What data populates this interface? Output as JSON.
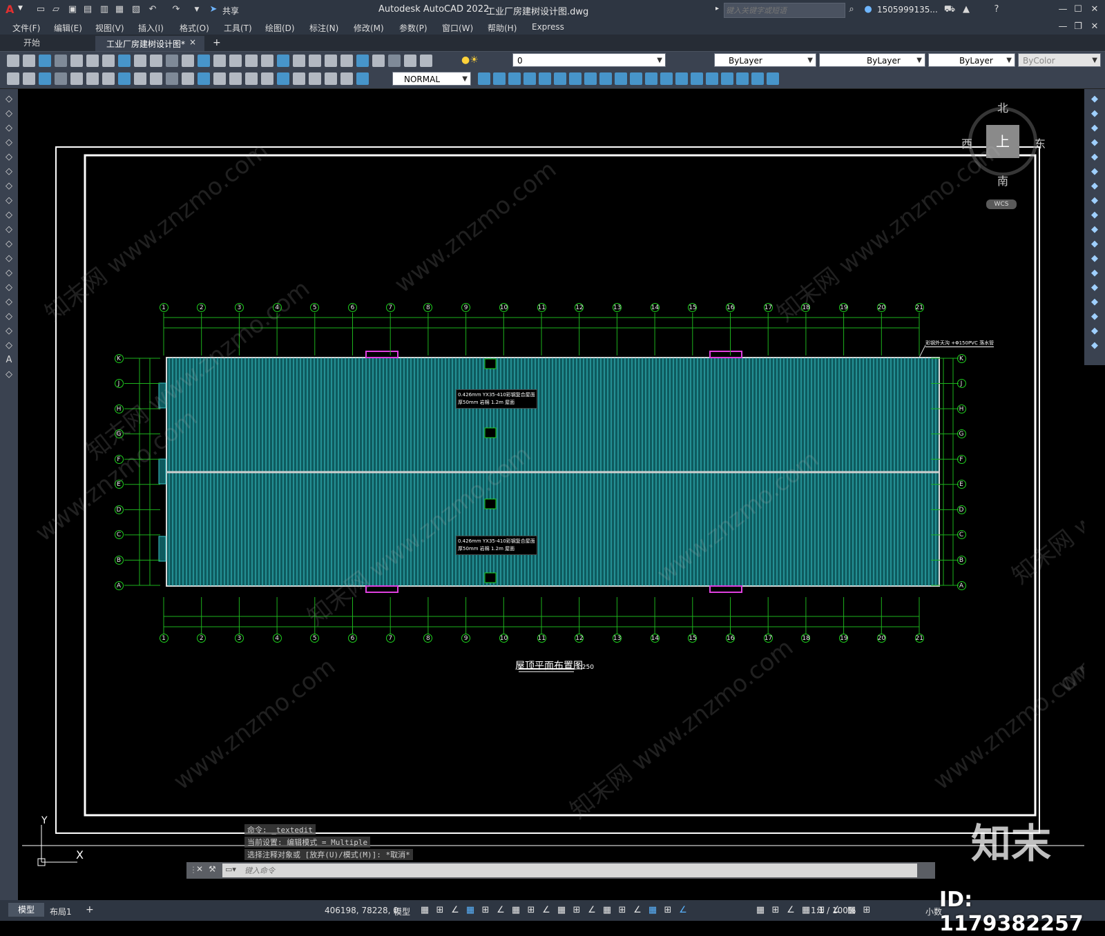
{
  "app": {
    "title": "Autodesk AutoCAD 2022",
    "file_title": "工业厂房建树设计图.dwg",
    "search_placeholder": "键入关键字或短语",
    "user": "1505999135...",
    "share_label": "共享",
    "app_letter": "A"
  },
  "menu": [
    "文件(F)",
    "编辑(E)",
    "视图(V)",
    "插入(I)",
    "格式(O)",
    "工具(T)",
    "绘图(D)",
    "标注(N)",
    "修改(M)",
    "参数(P)",
    "窗口(W)",
    "帮助(H)",
    "Express"
  ],
  "tabs": {
    "start": "开始",
    "doc": "工业厂房建树设计图*",
    "close": "×",
    "add": "+"
  },
  "toolbar": {
    "layer_value": "0",
    "color_value": "ByLayer",
    "linetype_value": "ByLayer",
    "lineweight_value": "ByLayer",
    "plotstyle_value": "ByColor",
    "textstyle_value": "NORMAL"
  },
  "viewcube": {
    "north": "北",
    "south": "南",
    "east": "东",
    "west": "西",
    "top": "上",
    "wcs": "WCS"
  },
  "drawing": {
    "grid_cols": [
      "1",
      "2",
      "3",
      "4",
      "5",
      "6",
      "7",
      "8",
      "9",
      "10",
      "11",
      "12",
      "13",
      "14",
      "15",
      "16",
      "17",
      "18",
      "19",
      "20",
      "21"
    ],
    "grid_rows": [
      "K",
      "J",
      "H",
      "G",
      "F",
      "E",
      "D",
      "C",
      "B",
      "A"
    ],
    "title": "屋顶平面布置图",
    "scale": "1:250",
    "note_top": "0.426mm YX35-410彩钢复合屋面",
    "note_top_2": "厚50mm 岩棉 1.2m 屋面",
    "note_bottom": "0.426mm YX35-410彩钢复合屋面",
    "note_bottom_2": "厚50mm 岩棉 1.2m 屋面",
    "pipe_note": "彩钢外天沟 +Φ150PVC 落水管"
  },
  "command": {
    "line1": "命令: _textedit",
    "line2": "当前设置: 编辑模式 = Multiple",
    "line3": "选择注释对象或 [放弃(U)/模式(M)]: *取消*",
    "placeholder": "键入命令"
  },
  "ucs": {
    "y": "Y",
    "x": "X"
  },
  "layout_tabs": [
    "模型",
    "布局1",
    "+"
  ],
  "status": {
    "coords": "406198, 78228, 0",
    "model": "模型",
    "scale": "1:1 / 100%",
    "units": "小数"
  },
  "watermark": {
    "brand": "知末",
    "id": "ID: 1179382257",
    "site": "www.znzmo.com",
    "site_cn": "知末网"
  }
}
